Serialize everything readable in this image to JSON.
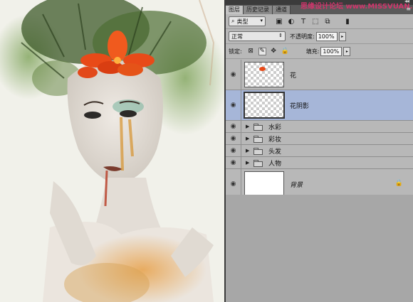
{
  "panel": {
    "tabs": [
      {
        "label": "图层",
        "active": true
      },
      {
        "label": "历史记录",
        "active": false
      },
      {
        "label": "通道",
        "active": false
      }
    ],
    "watermark": "思缘设计论坛 www.MISSVUAN.COM",
    "filter": {
      "label": "类型",
      "icon": "search-icon"
    },
    "filter_icons": [
      "image-filter-icon",
      "adjustment-filter-icon",
      "text-filter-icon",
      "shape-filter-icon",
      "smart-object-filter-icon",
      "filter-toggle-icon"
    ],
    "blend_mode": "正常",
    "opacity_label": "不透明度:",
    "opacity_value": "100%",
    "lock_label": "锁定:",
    "fill_label": "填充:",
    "fill_value": "100%",
    "layers": [
      {
        "name": "花",
        "kind": "layer",
        "visible": true,
        "selected": false
      },
      {
        "name": "花阴影",
        "kind": "layer",
        "visible": true,
        "selected": true
      },
      {
        "name": "水彩",
        "kind": "group",
        "visible": true
      },
      {
        "name": "彩妆",
        "kind": "group",
        "visible": true
      },
      {
        "name": "头发",
        "kind": "group",
        "visible": true
      },
      {
        "name": "人物",
        "kind": "group",
        "visible": true
      },
      {
        "name": "背景",
        "kind": "background",
        "visible": true,
        "locked": true
      }
    ],
    "selection_color": "#a6b6d8"
  }
}
